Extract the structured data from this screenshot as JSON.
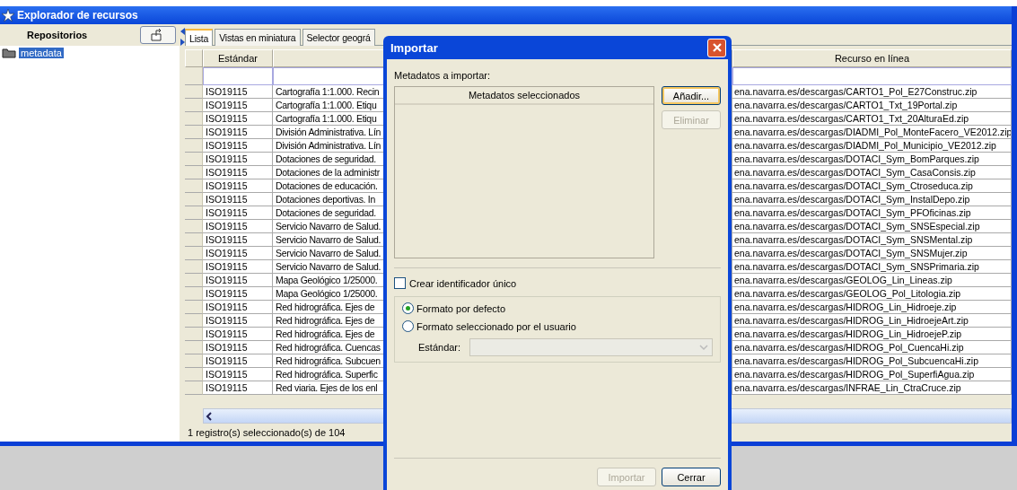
{
  "window": {
    "title": "Explorador de recursos"
  },
  "sidebar": {
    "header": "Repositorios",
    "items": [
      {
        "label": "metadata",
        "selected": true
      }
    ]
  },
  "tabs": [
    {
      "label": "Lista",
      "selected": true
    },
    {
      "label": "Vistas en miniatura",
      "selected": false
    },
    {
      "label": "Selector geográ",
      "selected": false
    }
  ],
  "table": {
    "columns": {
      "standard": "Estándar",
      "resource": "Recurso en línea"
    },
    "rows": [
      {
        "standard": "ISO19115",
        "title": "Cartografía 1:1.000. Recin",
        "resource": "ena.navarra.es/descargas/CARTO1_Pol_E27Construc.zip"
      },
      {
        "standard": "ISO19115",
        "title": "Cartografía 1:1.000. Etiqu",
        "resource": "ena.navarra.es/descargas/CARTO1_Txt_19Portal.zip"
      },
      {
        "standard": "ISO19115",
        "title": "Cartografía 1:1.000. Etiqu",
        "resource": "ena.navarra.es/descargas/CARTO1_Txt_20AlturaEd.zip"
      },
      {
        "standard": "ISO19115",
        "title": "División Administrativa. Lín",
        "resource": "ena.navarra.es/descargas/DIADMI_Pol_MonteFacero_VE2012.zip"
      },
      {
        "standard": "ISO19115",
        "title": "División Administrativa. Lín",
        "resource": "ena.navarra.es/descargas/DIADMI_Pol_Municipio_VE2012.zip"
      },
      {
        "standard": "ISO19115",
        "title": "Dotaciones de seguridad.",
        "resource": "ena.navarra.es/descargas/DOTACI_Sym_BomParques.zip"
      },
      {
        "standard": "ISO19115",
        "title": "Dotaciones de la administr",
        "resource": "ena.navarra.es/descargas/DOTACI_Sym_CasaConsis.zip"
      },
      {
        "standard": "ISO19115",
        "title": "Dotaciones de educación.",
        "resource": "ena.navarra.es/descargas/DOTACI_Sym_Ctroseduca.zip"
      },
      {
        "standard": "ISO19115",
        "title": "Dotaciones deportivas. In",
        "resource": "ena.navarra.es/descargas/DOTACI_Sym_InstalDepo.zip"
      },
      {
        "standard": "ISO19115",
        "title": "Dotaciones de seguridad.",
        "resource": "ena.navarra.es/descargas/DOTACI_Sym_PFOficinas.zip"
      },
      {
        "standard": "ISO19115",
        "title": "Servicio Navarro de Salud.",
        "resource": "ena.navarra.es/descargas/DOTACI_Sym_SNSEspecial.zip"
      },
      {
        "standard": "ISO19115",
        "title": "Servicio Navarro de Salud.",
        "resource": "ena.navarra.es/descargas/DOTACI_Sym_SNSMental.zip"
      },
      {
        "standard": "ISO19115",
        "title": "Servicio Navarro de Salud.",
        "resource": "ena.navarra.es/descargas/DOTACI_Sym_SNSMujer.zip"
      },
      {
        "standard": "ISO19115",
        "title": "Servicio Navarro de Salud.",
        "resource": "ena.navarra.es/descargas/DOTACI_Sym_SNSPrimaria.zip"
      },
      {
        "standard": "ISO19115",
        "title": "Mapa Geológico 1/25000.",
        "resource": "ena.navarra.es/descargas/GEOLOG_Lin_Lineas.zip"
      },
      {
        "standard": "ISO19115",
        "title": "Mapa Geológico 1/25000.",
        "resource": "ena.navarra.es/descargas/GEOLOG_Pol_Litologia.zip"
      },
      {
        "standard": "ISO19115",
        "title": "Red hidrográfica. Ejes de",
        "resource": "ena.navarra.es/descargas/HIDROG_Lin_Hidroeje.zip"
      },
      {
        "standard": "ISO19115",
        "title": "Red hidrográfica. Ejes de",
        "resource": "ena.navarra.es/descargas/HIDROG_Lin_HidroejeArt.zip"
      },
      {
        "standard": "ISO19115",
        "title": "Red hidrográfica. Ejes de",
        "resource": "ena.navarra.es/descargas/HIDROG_Lin_HidroejeP.zip"
      },
      {
        "standard": "ISO19115",
        "title": "Red hidrográfica. Cuencas",
        "resource": "ena.navarra.es/descargas/HIDROG_Pol_CuencaHi.zip"
      },
      {
        "standard": "ISO19115",
        "title": "Red hidrográfica. Subcuen",
        "resource": "ena.navarra.es/descargas/HIDROG_Pol_SubcuencaHi.zip"
      },
      {
        "standard": "ISO19115",
        "title": "Red hidrográfica. Superfic",
        "resource": "ena.navarra.es/descargas/HIDROG_Pol_SuperfiAgua.zip"
      },
      {
        "standard": "ISO19115",
        "title": "Red viaria. Ejes de los enl",
        "resource": "ena.navarra.es/descargas/INFRAE_Lin_CtraCruce.zip"
      }
    ]
  },
  "status_bar": "1 registro(s) seleccionado(s) de 104",
  "dialog": {
    "title": "Importar",
    "list_label": "Metadatos a importar:",
    "list_header": "Metadatos seleccionados",
    "side_buttons": [
      {
        "label": "Añadir...",
        "disabled": false
      },
      {
        "label": "Eliminar",
        "disabled": true
      }
    ],
    "checkbox": {
      "label": "Crear identificador único",
      "checked": false
    },
    "radios": [
      {
        "label": "Formato por defecto",
        "selected": true
      },
      {
        "label": "Formato seleccionado por el usuario",
        "selected": false
      }
    ],
    "standard_field": {
      "label": "Estándar:",
      "disabled": true
    },
    "footer_buttons": [
      {
        "label": "Importar",
        "disabled": true
      },
      {
        "label": "Cerrar",
        "disabled": false
      }
    ]
  }
}
